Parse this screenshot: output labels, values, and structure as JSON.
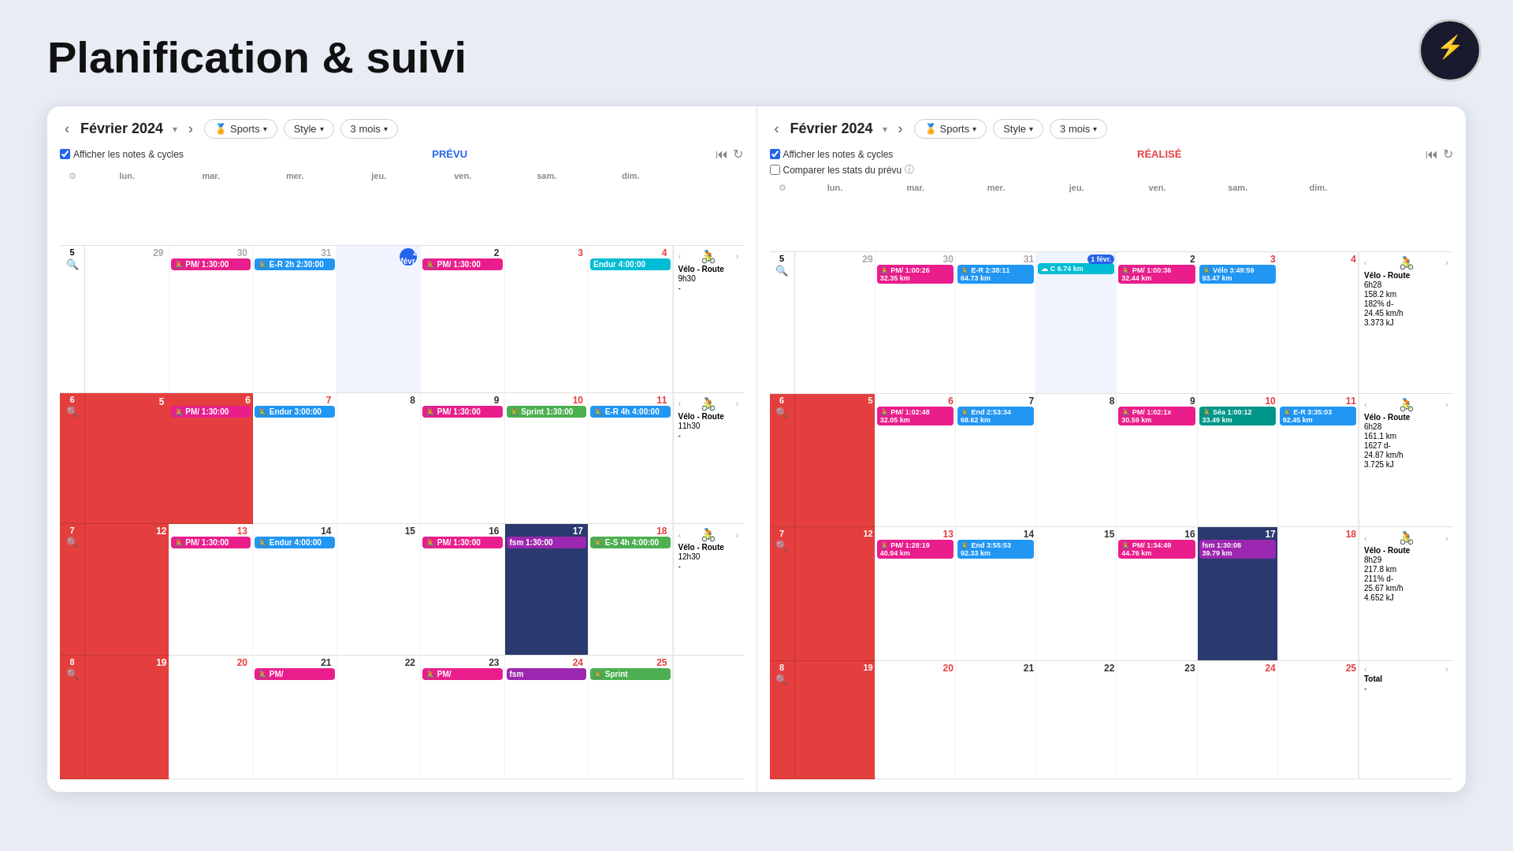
{
  "page": {
    "title": "Planification & suivi",
    "background": "#e8edf5"
  },
  "left_panel": {
    "month": "Février 2024",
    "label": "PRÉVU",
    "show_notes": "Afficher les notes & cycles",
    "sports_btn": "Sports",
    "style_btn": "Style",
    "period_btn": "3 mois",
    "days": [
      "lun.",
      "mar.",
      "mer.",
      "jeu.",
      "ven.",
      "sam.",
      "dim."
    ],
    "weeks": [
      {
        "num": "5",
        "days_nums": [
          "29",
          "30",
          "31",
          "1 févr.",
          "2",
          "3",
          "4"
        ],
        "highlight_day": 3,
        "events": {
          "mar": [
            {
              "label": "PM/ 1:30:00",
              "color": "event-pink",
              "icon": "🚴"
            }
          ],
          "mer": [
            {
              "label": "E-R 2h 2:30:00",
              "color": "event-blue",
              "icon": "🚴"
            }
          ],
          "ven": [
            {
              "label": "PM/ 1:30:00",
              "color": "event-pink",
              "icon": "🚴"
            }
          ],
          "dim": [
            {
              "label": "Endur 4:00:00",
              "color": "event-cyan",
              "icon": ""
            }
          ]
        },
        "summary": {
          "icon": "🚴",
          "title": "Vélo - Route",
          "time": "9h30",
          "dist": "-"
        }
      },
      {
        "num": "6",
        "is_red": true,
        "days_nums": [
          "5",
          "6",
          "7",
          "8",
          "9",
          "10",
          "11"
        ],
        "events": {
          "mar": [
            {
              "label": "PM/ 1:30:00",
              "color": "event-pink",
              "icon": "🚴"
            }
          ],
          "mer": [
            {
              "label": "Endur 3:00:00",
              "color": "event-blue",
              "icon": "🚴"
            }
          ],
          "ven": [
            {
              "label": "PM/ 1:30:00",
              "color": "event-pink",
              "icon": "🚴"
            }
          ],
          "sam": [
            {
              "label": "Sprint 1:30:00",
              "color": "event-green",
              "icon": "🚴"
            }
          ],
          "dim": [
            {
              "label": "E-R 4h 4:00:00",
              "color": "event-blue",
              "icon": "🚴"
            }
          ]
        },
        "summary": {
          "icon": "🚴",
          "title": "Vélo - Route",
          "time": "11h30",
          "dist": "-"
        }
      },
      {
        "num": "7",
        "is_red": true,
        "days_nums": [
          "12",
          "13",
          "14",
          "15",
          "16",
          "17",
          "18"
        ],
        "highlight_day": 5,
        "events": {
          "mar": [
            {
              "label": "PM/ 1:30:00",
              "color": "event-pink",
              "icon": "🚴"
            }
          ],
          "mer": [
            {
              "label": "Endur 4:00:00",
              "color": "event-blue",
              "icon": "🚴"
            }
          ],
          "ven": [
            {
              "label": "PM/ 1:30:00",
              "color": "event-pink",
              "icon": "🚴"
            }
          ],
          "sam": [
            {
              "label": "fsm 1:30:00",
              "color": "event-purple",
              "icon": ""
            }
          ],
          "dim": [
            {
              "label": "E-S 4h 4:00:00",
              "color": "event-green",
              "icon": "🚴"
            }
          ]
        },
        "summary": {
          "icon": "🚴",
          "title": "Vélo - Route",
          "time": "12h30",
          "dist": "-"
        }
      },
      {
        "num": "8",
        "is_red": true,
        "days_nums": [
          "19",
          "20",
          "21",
          "22",
          "23",
          "24",
          "25"
        ],
        "events": {
          "mer": [
            {
              "label": "PM/",
              "color": "event-pink",
              "icon": "🚴"
            }
          ],
          "ven": [
            {
              "label": "PM/",
              "color": "event-pink",
              "icon": "🚴"
            }
          ],
          "sam": [
            {
              "label": "fsm",
              "color": "event-purple",
              "icon": ""
            }
          ],
          "dim": [
            {
              "label": "Sprint",
              "color": "event-green",
              "icon": "🚴"
            }
          ]
        },
        "summary": {
          "icon": "",
          "title": "",
          "time": "",
          "dist": ""
        }
      }
    ]
  },
  "right_panel": {
    "month": "Février 2024",
    "label": "RÉALISÉ",
    "show_notes": "Afficher les notes & cycles",
    "compare_stats": "Comparer les stats du prévu",
    "sports_btn": "Sports",
    "style_btn": "Style",
    "period_btn": "3 mois",
    "days": [
      "lun.",
      "mar.",
      "mer.",
      "jeu.",
      "ven.",
      "sam.",
      "dim."
    ],
    "weeks": [
      {
        "num": "5",
        "days_nums": [
          "29",
          "30",
          "31",
          "1 févr.",
          "2",
          "3",
          "4"
        ],
        "highlight_day": 3,
        "events": {
          "mar": [
            {
              "label": "PM/ 1:00:26 32.35 km",
              "color": "event-pink",
              "icon": "🚴"
            }
          ],
          "mer": [
            {
              "label": "E-R 2:38:11 64.73 km",
              "color": "event-blue",
              "icon": "🚴"
            }
          ],
          "jeu": [
            {
              "label": "C 6.74 km",
              "color": "event-cyan",
              "icon": "☁"
            }
          ],
          "ven": [
            {
              "label": "PM/ 1:00:36 32.44 km",
              "color": "event-pink",
              "icon": "🚴"
            }
          ],
          "sam": [
            {
              "label": "Vélo 3:49:59 93.47 km",
              "color": "event-blue",
              "icon": "🚴"
            }
          ]
        },
        "summary": {
          "icon": "🚴",
          "title": "Vélo - Route",
          "time": "6h28",
          "dist": "158.2 km",
          "elev": "182% d-",
          "speed": "24.45 km/h",
          "energy": "3.373 kJ"
        }
      },
      {
        "num": "6",
        "is_red": true,
        "days_nums": [
          "5",
          "6",
          "7",
          "8",
          "9",
          "10",
          "11"
        ],
        "events": {
          "mar": [
            {
              "label": "PM/ 1:02:48 32.05 km",
              "color": "event-pink",
              "icon": "🚴"
            }
          ],
          "mer": [
            {
              "label": "End 2:53:34 68.62 km",
              "color": "event-blue",
              "icon": "🚴"
            }
          ],
          "ven": [
            {
              "label": "PM/ 1:02:1x 30.59 km",
              "color": "event-pink",
              "icon": "🚴"
            }
          ],
          "sam": [
            {
              "label": "Séa 1:00:12 33.49 km",
              "color": "event-teal",
              "icon": "🚴"
            }
          ],
          "dim": [
            {
              "label": "E-R 3:35:03 92.45 km",
              "color": "event-blue",
              "icon": "🚴"
            }
          ]
        },
        "summary": {
          "icon": "🚴",
          "title": "Vélo - Route",
          "time": "6h28",
          "dist": "161.1 km",
          "elev": "1627 d-",
          "speed": "24.87 km/h",
          "energy": "3.725 kJ"
        }
      },
      {
        "num": "7",
        "is_red": true,
        "days_nums": [
          "12",
          "13",
          "14",
          "15",
          "16",
          "17",
          "18"
        ],
        "highlight_day": 5,
        "events": {
          "mar": [
            {
              "label": "PM/ 1:28:19 40.94 km",
              "color": "event-pink",
              "icon": "🚴"
            }
          ],
          "mer": [
            {
              "label": "End 3:55:53 92.33 km",
              "color": "event-blue",
              "icon": "🚴"
            }
          ],
          "ven": [
            {
              "label": "PM/ 1:34:49 44.76 km",
              "color": "event-pink",
              "icon": "🚴"
            }
          ],
          "sam": [
            {
              "label": "fsm 1:30:08 39.79 km",
              "color": "event-purple",
              "icon": ""
            }
          ]
        },
        "summary": {
          "icon": "🚴",
          "title": "Vélo - Route",
          "time": "8h29",
          "dist": "217.8 km",
          "elev": "211% d-",
          "speed": "25.67 km/h",
          "energy": "4.652 kJ"
        }
      },
      {
        "num": "8",
        "is_red": true,
        "days_nums": [
          "19",
          "20",
          "21",
          "22",
          "23",
          "24",
          "25"
        ],
        "events": {},
        "summary": {
          "icon": "",
          "title": "Total",
          "time": "",
          "dist": "-"
        }
      }
    ]
  }
}
